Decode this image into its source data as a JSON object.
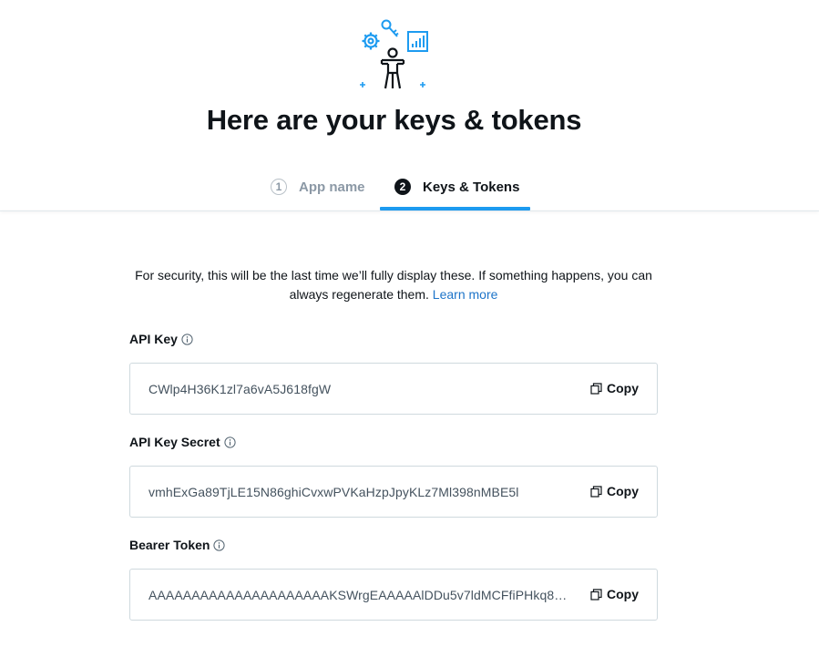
{
  "header": {
    "title": "Here are your keys & tokens",
    "illustration_icon": "person-with-gear-key-chart-illustration",
    "accent_color": "#1d9bf0"
  },
  "stepper": {
    "steps": [
      {
        "number": "1",
        "label": "App name",
        "active": false
      },
      {
        "number": "2",
        "label": "Keys & Tokens",
        "active": true
      }
    ]
  },
  "security_note": {
    "text": "For security, this will be the last time we’ll fully display these. If something happens, you can always regenerate them.",
    "link_label": "Learn more"
  },
  "fields": [
    {
      "label": "API Key",
      "value": "CWlp4H36K1zl7a6vA5J618fgW",
      "copy_label": "Copy"
    },
    {
      "label": "API Key Secret",
      "value": "vmhExGa89TjLE15N86ghiCvxwPVKaHzpJpyKLz7Ml398nMBE5l",
      "copy_label": "Copy"
    },
    {
      "label": "Bearer Token",
      "value": "AAAAAAAAAAAAAAAAAAAAAKSWrgEAAAAAlDDu5v7ldMCFfiPHkq8…",
      "copy_label": "Copy"
    }
  ]
}
